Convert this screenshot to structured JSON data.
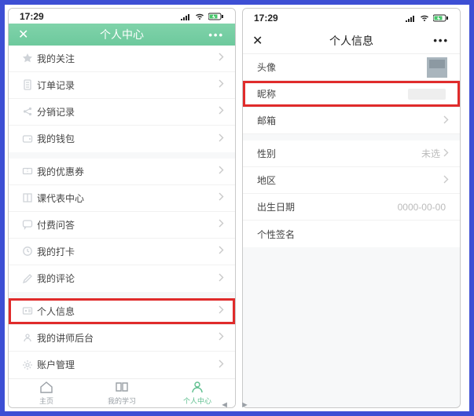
{
  "statusbar": {
    "time": "17:29"
  },
  "left": {
    "nav": {
      "title": "个人中心",
      "close": "✕",
      "more": "•••"
    },
    "group1": [
      {
        "icon": "star-icon",
        "label": "我的关注"
      },
      {
        "icon": "doc-icon",
        "label": "订单记录"
      },
      {
        "icon": "share-icon",
        "label": "分销记录"
      },
      {
        "icon": "wallet-icon",
        "label": "我的钱包"
      }
    ],
    "group2": [
      {
        "icon": "ticket-icon",
        "label": "我的优惠券"
      },
      {
        "icon": "book-icon",
        "label": "课代表中心"
      },
      {
        "icon": "qa-icon",
        "label": "付费问答"
      },
      {
        "icon": "clock-icon",
        "label": "我的打卡"
      },
      {
        "icon": "edit-icon",
        "label": "我的评论"
      }
    ],
    "group3": [
      {
        "icon": "idcard-icon",
        "label": "个人信息",
        "highlight": true
      },
      {
        "icon": "teacher-icon",
        "label": "我的讲师后台"
      },
      {
        "icon": "gear-icon",
        "label": "账户管理"
      }
    ],
    "tabs": [
      {
        "icon": "home-icon",
        "label": "主页"
      },
      {
        "icon": "study-icon",
        "label": "我的学习"
      },
      {
        "icon": "user-icon",
        "label": "个人中心",
        "active": true
      }
    ]
  },
  "right": {
    "nav": {
      "title": "个人信息",
      "close": "✕",
      "more": "•••"
    },
    "rows": [
      {
        "label": "头像",
        "avatar": true
      },
      {
        "label": "昵称",
        "redacted": true,
        "highlight": true
      },
      {
        "label": "邮箱",
        "chev": true
      },
      {
        "spacer": true
      },
      {
        "label": "性别",
        "value": "未选",
        "chev": true
      },
      {
        "label": "地区",
        "chev": true
      },
      {
        "label": "出生日期",
        "value": "0000-00-00"
      },
      {
        "label": "个性签名"
      }
    ]
  },
  "footer_arrows": "◄  ►"
}
